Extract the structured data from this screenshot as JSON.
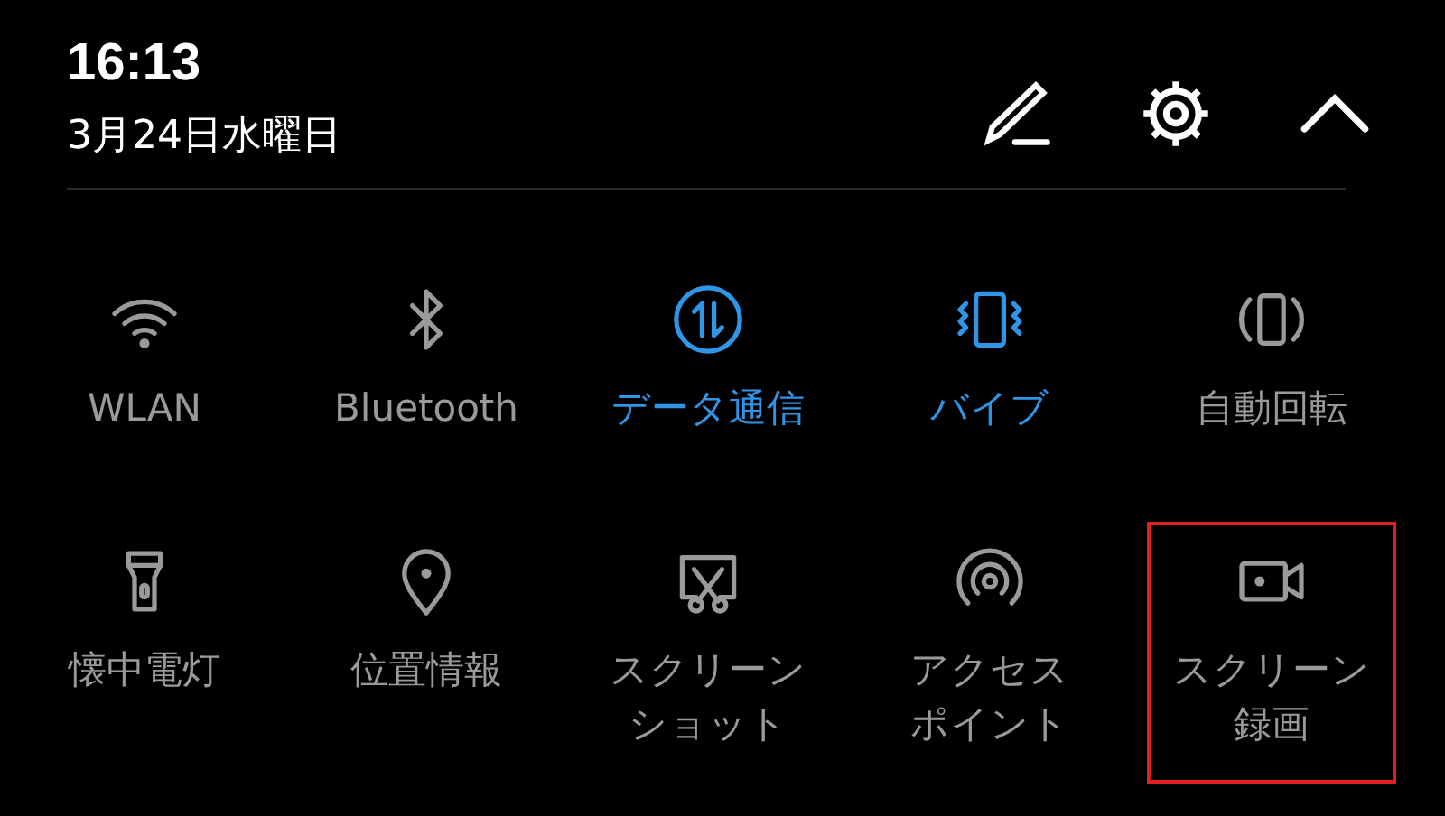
{
  "header": {
    "time": "16:13",
    "date": "3月24日水曜日"
  },
  "tiles": [
    {
      "lines": [
        "WLAN"
      ],
      "on": false,
      "highlighted": false
    },
    {
      "lines": [
        "Bluetooth"
      ],
      "on": false,
      "highlighted": false
    },
    {
      "lines": [
        "データ通信"
      ],
      "on": true,
      "highlighted": false
    },
    {
      "lines": [
        "バイブ"
      ],
      "on": true,
      "highlighted": false
    },
    {
      "lines": [
        "自動回転"
      ],
      "on": false,
      "highlighted": false
    },
    {
      "lines": [
        "懐中電灯"
      ],
      "on": false,
      "highlighted": false
    },
    {
      "lines": [
        "位置情報"
      ],
      "on": false,
      "highlighted": false
    },
    {
      "lines": [
        "スクリーン",
        "ショット"
      ],
      "on": false,
      "highlighted": false
    },
    {
      "lines": [
        "アクセス",
        "ポイント"
      ],
      "on": false,
      "highlighted": false
    },
    {
      "lines": [
        "スクリーン",
        "録画"
      ],
      "on": false,
      "highlighted": true
    }
  ]
}
